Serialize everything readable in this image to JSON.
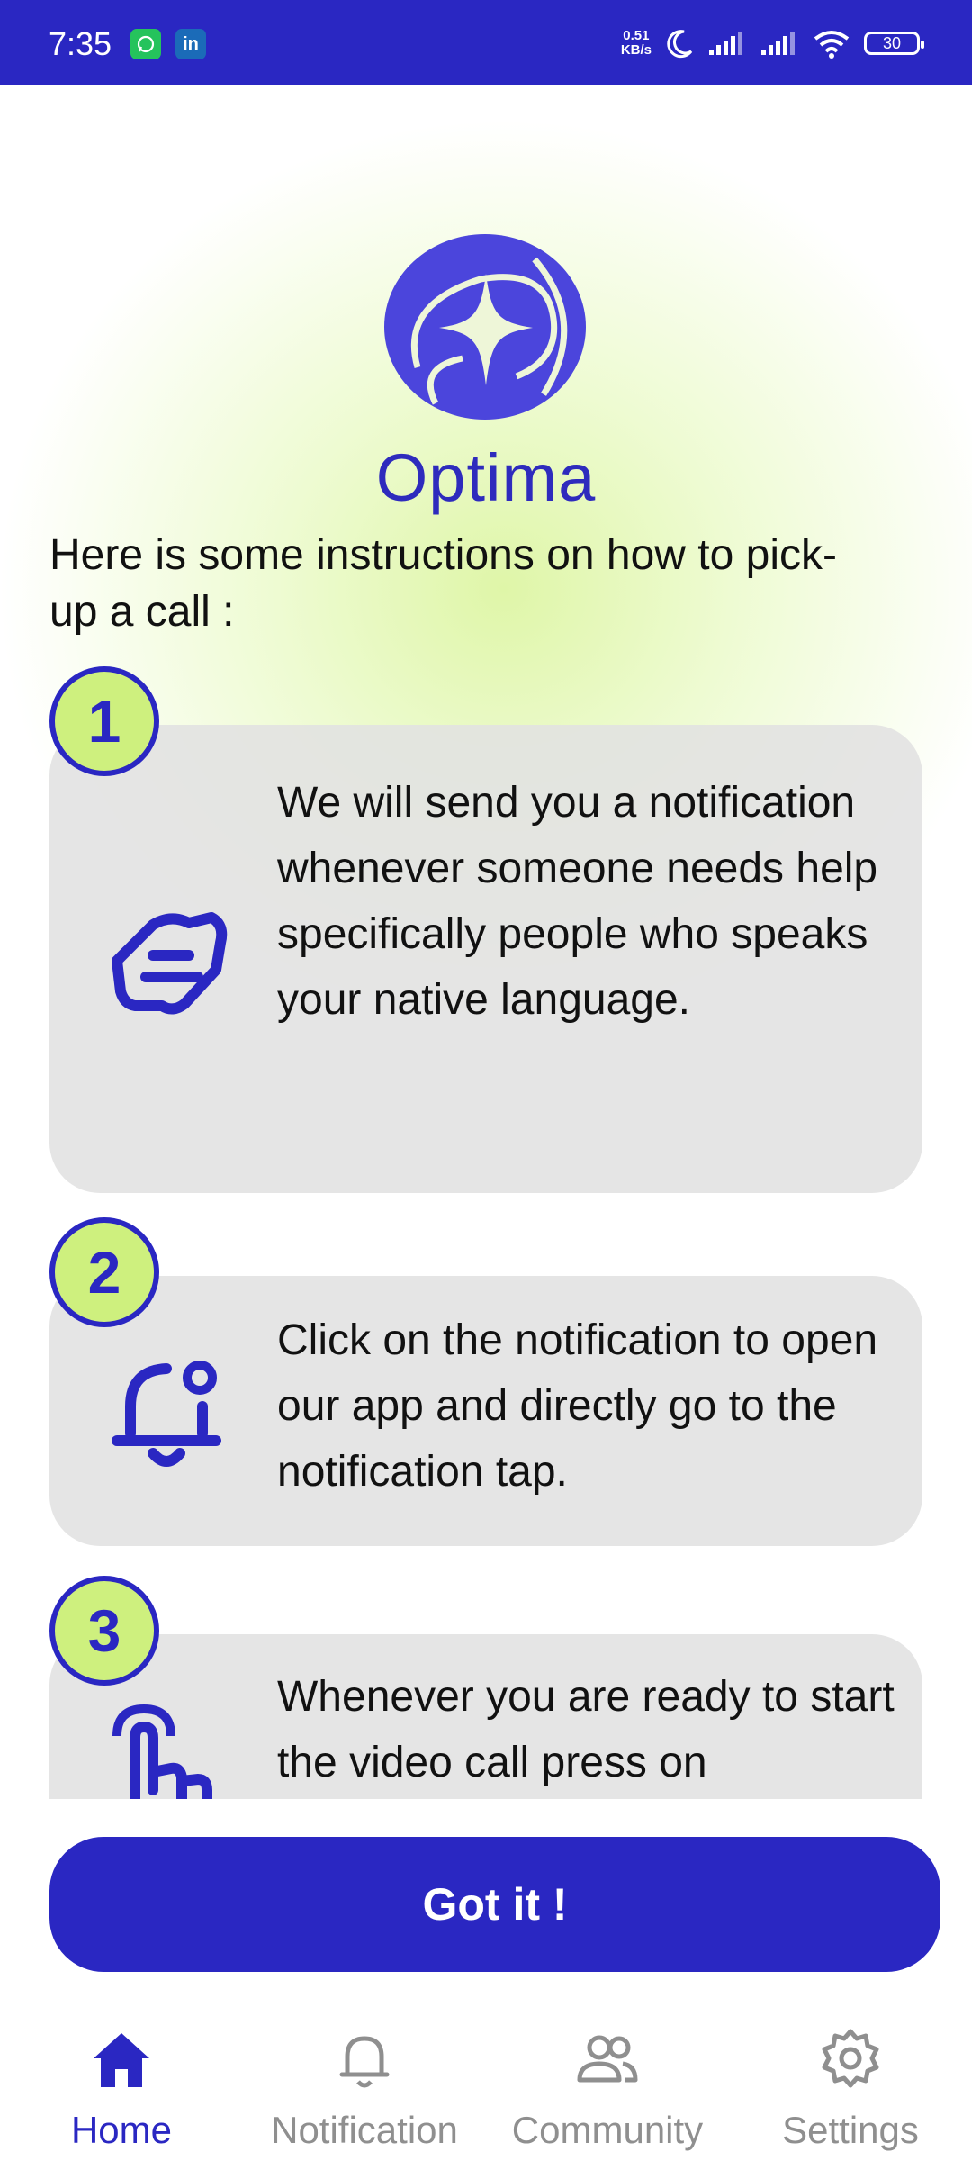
{
  "status_bar": {
    "time": "7:35",
    "app_badges": [
      "whatsapp-icon",
      "linkedin-icon"
    ],
    "net_speed_value": "0.51",
    "net_speed_unit": "KB/s",
    "battery": "30"
  },
  "app": {
    "title": "Optima",
    "intro": "Here is some instructions on how to pick-up a call :"
  },
  "steps": [
    {
      "number": "1",
      "icon": "handshake-icon",
      "text": "We will send you a notification whenever someone needs help specifically people who speaks your native language."
    },
    {
      "number": "2",
      "icon": "bell-notification-icon",
      "text": "Click on the notification to open our app and directly go to the notification tap."
    },
    {
      "number": "3",
      "icon": "tap-hand-icon",
      "text": "Whenever you are ready to start the video call press on"
    }
  ],
  "got_it_button": "Got it !",
  "nav": {
    "items": [
      {
        "label": "Home",
        "icon": "home-icon",
        "active": true
      },
      {
        "label": "Notification",
        "icon": "bell-icon",
        "active": false
      },
      {
        "label": "Community",
        "icon": "people-icon",
        "active": false
      },
      {
        "label": "Settings",
        "icon": "gear-icon",
        "active": false
      }
    ]
  },
  "colors": {
    "primary": "#2a27c2",
    "accent": "#cef07e",
    "card": "#e3e3e3"
  }
}
